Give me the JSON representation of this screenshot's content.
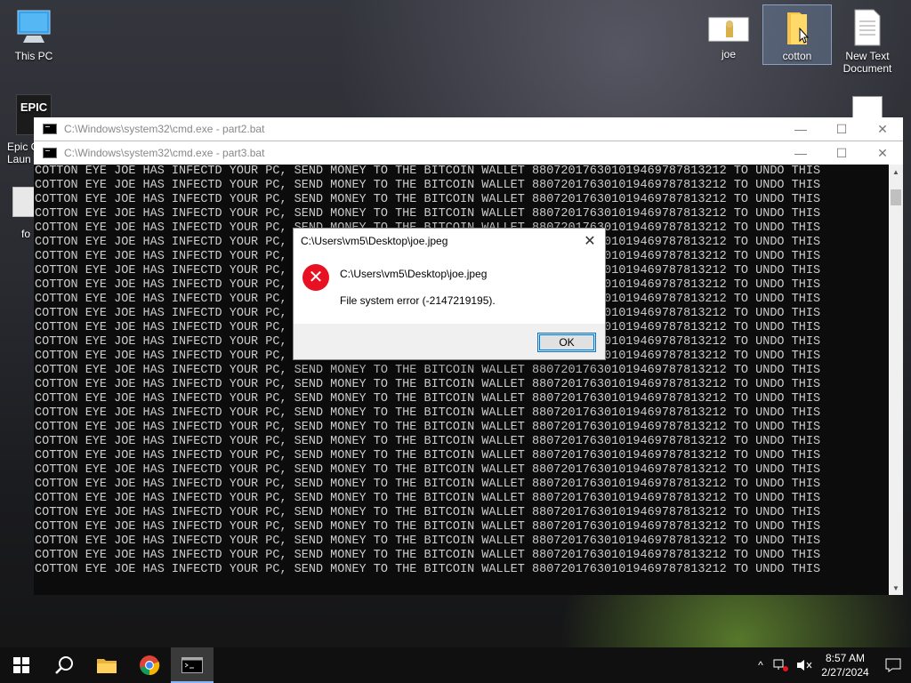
{
  "desktop": {
    "icons": [
      {
        "label": "This PC"
      },
      {
        "label": "EPIC"
      },
      {
        "label": "Epic G\nLaun"
      },
      {
        "label": "fo"
      },
      {
        "label": "joe"
      },
      {
        "label": "cotton"
      },
      {
        "label": "New Text\nDocument"
      }
    ]
  },
  "window_back": {
    "title": "C:\\Windows\\system32\\cmd.exe - part2.bat"
  },
  "window_front": {
    "title": "C:\\Windows\\system32\\cmd.exe - part3.bat",
    "line_text": "COTTON EYE JOE HAS INFECTD YOUR PC, SEND MONEY TO THE BITCOIN WALLET 880720176301019469787813212 TO UNDO THIS",
    "line_count": 29
  },
  "dialog": {
    "title": "C:\\Users\\vm5\\Desktop\\joe.jpeg",
    "path": "C:\\Users\\vm5\\Desktop\\joe.jpeg",
    "message": "File system error (-2147219195).",
    "ok_label": "OK",
    "close_label": "✕"
  },
  "taskbar": {
    "time": "8:57 AM",
    "date": "2/27/2024"
  },
  "colors": {
    "console_bg": "#0c0c0c",
    "console_text": "#cccccc",
    "error_red": "#e81123",
    "accent": "#0078d7"
  }
}
